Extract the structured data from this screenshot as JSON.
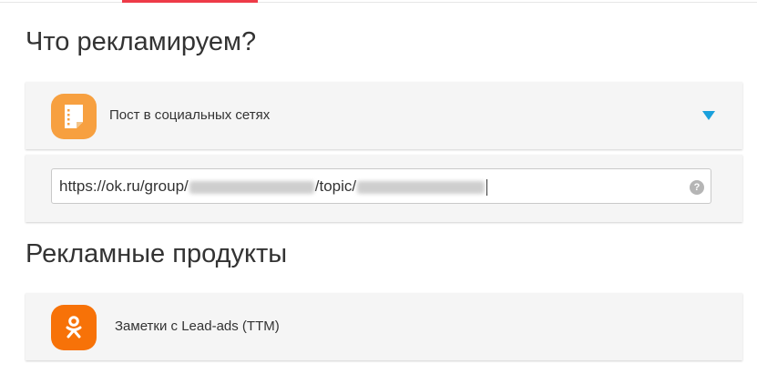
{
  "sections": {
    "what_title": "Что рекламируем?",
    "products_title": "Рекламные продукты"
  },
  "promo_type": {
    "label": "Пост в социальных сетях",
    "icon": "post-document-icon"
  },
  "url_field": {
    "prefix": "https://ok.ru/group/",
    "middle": "/topic/",
    "help_symbol": "?"
  },
  "product": {
    "label": "Заметки с Lead-ads (TTM)",
    "icon": "odnoklassniki-logo-icon"
  },
  "colors": {
    "accent_tab": "#ee3b48",
    "dropdown_arrow": "#1aa0dc",
    "post_icon_bg": "#f7a040",
    "ok_icon_bg": "#f77208"
  }
}
